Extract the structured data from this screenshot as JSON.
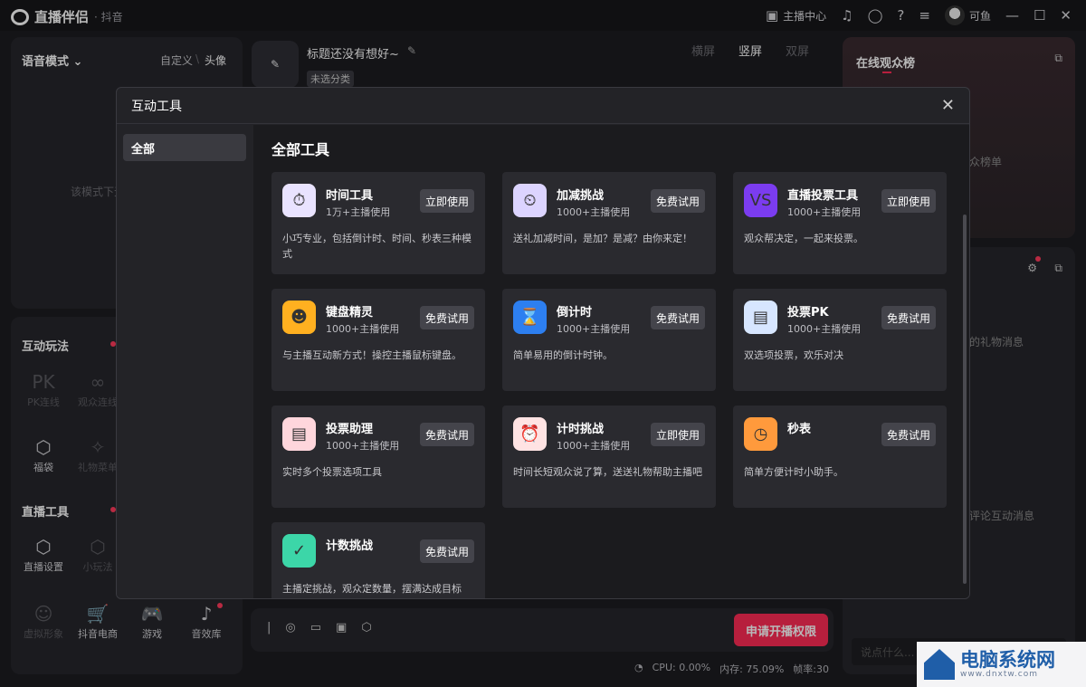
{
  "app": {
    "name": "直播伴侣",
    "sub": "· 抖音"
  },
  "titlebar": {
    "anchor_center": "主播中心",
    "username": "可鱼",
    "min": "—",
    "max": "☐",
    "close": "✕"
  },
  "left": {
    "voice_mode": "语音模式",
    "customize": "自定义",
    "sep": "\\",
    "avatar": "头像",
    "voice_hint": "该模式下无",
    "interactive": "互动玩法",
    "items1": [
      "PK连线",
      "观众连线"
    ],
    "items2": [
      "福袋",
      "礼物菜单"
    ],
    "live_tools": "直播工具",
    "items3": [
      "直播设置",
      "小玩法"
    ],
    "items4": [
      "虚拟形象",
      "抖音电商",
      "游戏",
      "音效库"
    ]
  },
  "center": {
    "title": "标题还没有想好~",
    "category": "未选分类",
    "orient": [
      "横屏",
      "竖屏",
      "双屏"
    ],
    "apply": "申请开播权限"
  },
  "right": {
    "online_rank": "在线观众榜",
    "rank_hint": "众榜单",
    "gift_hint": "的礼物消息",
    "comment_hint": "评论互动消息",
    "say_placeholder": "说点什么..."
  },
  "status": {
    "cpu": "CPU: 0.00%",
    "mem": "内存: 75.09%",
    "fps": "帧率:30"
  },
  "modal": {
    "title": "互动工具",
    "close": "✕",
    "side_all": "全部",
    "body_title": "全部工具",
    "cards": [
      {
        "name": "时间工具",
        "users": "1万+主播使用",
        "button": "立即使用",
        "desc": "小巧专业，包括倒计时、时间、秒表三种模式",
        "icon": "stopwatch-icon",
        "color": "#e9e3ff"
      },
      {
        "name": "加减挑战",
        "users": "1000+主播使用",
        "button": "免费试用",
        "desc": "送礼加减时间，是加？是减？由你来定！",
        "icon": "timer-plus-icon",
        "color": "#dcd4ff"
      },
      {
        "name": "直播投票工具",
        "users": "1000+主播使用",
        "button": "立即使用",
        "desc": "观众帮决定，一起来投票。",
        "icon": "vs-icon",
        "color": "#7b3cf0"
      },
      {
        "name": "键盘精灵",
        "users": "1000+主播使用",
        "button": "免费试用",
        "desc": "与主播互动新方式！操控主播鼠标键盘。",
        "icon": "devil-icon",
        "color": "#ffb020"
      },
      {
        "name": "倒计时",
        "users": "1000+主播使用",
        "button": "免费试用",
        "desc": "简单易用的倒计时钟。",
        "icon": "hourglass-icon",
        "color": "#2d7ff0"
      },
      {
        "name": "投票PK",
        "users": "1000+主播使用",
        "button": "免费试用",
        "desc": "双选项投票，欢乐对决",
        "icon": "vote-pk-icon",
        "color": "#d7e6ff"
      },
      {
        "name": "投票助理",
        "users": "1000+主播使用",
        "button": "免费试用",
        "desc": "实时多个投票选项工具",
        "icon": "vote-helper-icon",
        "color": "#ffd6dc"
      },
      {
        "name": "计时挑战",
        "users": "1000+主播使用",
        "button": "立即使用",
        "desc": "时间长短观众说了算，送送礼物帮助主播吧",
        "icon": "alarm-clock-icon",
        "color": "#ffe3e3"
      },
      {
        "name": "秒表",
        "users": "",
        "button": "免费试用",
        "desc": "简单方便计时小助手。",
        "icon": "stopwatch-orange-icon",
        "color": "#ff9a3c"
      },
      {
        "name": "计数挑战",
        "users": "",
        "button": "免费试用",
        "desc": "主播定挑战，观众定数量，摆满达成目标",
        "icon": "count-calendar-icon",
        "color": "#3cd6a8"
      }
    ]
  },
  "watermark": {
    "main": "电脑系统网",
    "sub": "www.dnxtw.com"
  }
}
